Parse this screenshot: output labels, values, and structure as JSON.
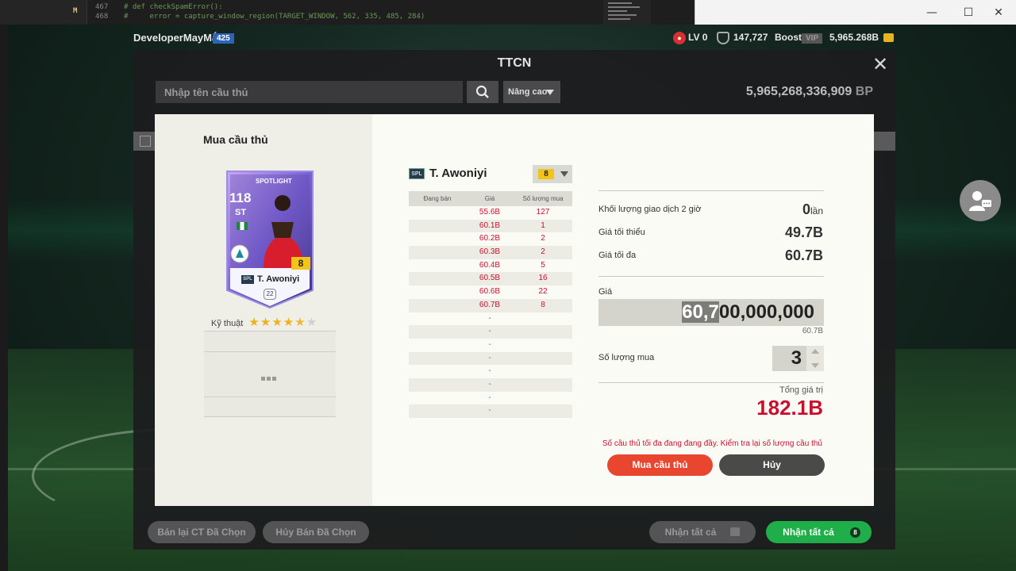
{
  "editor": {
    "modified_mark": "M",
    "lines": [
      {
        "num": "467",
        "text": "# def checkSpamError():"
      },
      {
        "num": "468",
        "text": "#     error = capture_window_region(TARGET_WINDOW, 562, 335, 485, 284)"
      }
    ]
  },
  "window": {
    "minimize": "—",
    "maximize": "☐",
    "close": "✕"
  },
  "topbar": {
    "username": "DeveloperMayMắn",
    "user_badge": "425",
    "level": "LV 0",
    "points": "147,727",
    "boost_label": "Boost",
    "vip_label": "VIP",
    "bp": "5,965.268B"
  },
  "panel": {
    "title": "TTCN",
    "search_placeholder": "Nhập tên cầu thủ",
    "advanced_label": "Nâng cao",
    "bp_value": "5,965,268,336,909",
    "bp_unit": "BP",
    "resell_button": "Bán lại CT Đã Chọn",
    "cancel_sell_button": "Hủy Bán Đã Chọn",
    "receive_all_grey": "Nhận tất cả",
    "receive_all_green": "Nhận tất cả",
    "receive_count": "8"
  },
  "dialog": {
    "title": "Mua cầu thủ",
    "card": {
      "ovr": "118",
      "position": "ST",
      "season": "SPOTLIGHT",
      "name": "T. Awoniyi",
      "league_badge": "SPL",
      "upgrade_level": "8",
      "skill_level": "22"
    },
    "skill_label": "Kỹ thuật",
    "skill_stars": 5,
    "skill_stars_filled": 4.5,
    "player_name": "T. Awoniyi",
    "league_badge": "SPL",
    "selected_level": "8",
    "orders": {
      "headers": [
        "Đang bán",
        "Giá",
        "Số lượng mua"
      ],
      "rows": [
        {
          "selling": "",
          "price": "55.6B",
          "qty": "127"
        },
        {
          "selling": "",
          "price": "60.1B",
          "qty": "1"
        },
        {
          "selling": "",
          "price": "60.2B",
          "qty": "2"
        },
        {
          "selling": "",
          "price": "60.3B",
          "qty": "2"
        },
        {
          "selling": "",
          "price": "60.4B",
          "qty": "5"
        },
        {
          "selling": "",
          "price": "60.5B",
          "qty": "16"
        },
        {
          "selling": "",
          "price": "60.6B",
          "qty": "22"
        },
        {
          "selling": "",
          "price": "60.7B",
          "qty": "8"
        },
        {
          "selling": "",
          "price": "-",
          "qty": ""
        },
        {
          "selling": "",
          "price": "-",
          "qty": ""
        },
        {
          "selling": "",
          "price": "-",
          "qty": ""
        },
        {
          "selling": "",
          "price": "-",
          "qty": ""
        },
        {
          "selling": "",
          "price": "-",
          "qty": ""
        },
        {
          "selling": "",
          "price": "-",
          "qty": ""
        },
        {
          "selling": "",
          "price": "-",
          "qty": ""
        },
        {
          "selling": "",
          "price": "-",
          "qty": ""
        }
      ]
    },
    "volume_label": "Khối lượng giao dịch 2 giờ",
    "volume_value": "0",
    "volume_unit": "lần",
    "min_label": "Giá tối thiểu",
    "min_value": "49.7B",
    "max_label": "Giá tối đa",
    "max_value": "60.7B",
    "price_label": "Giá",
    "price_selected": "60,7",
    "price_rest": "00,000,000",
    "price_short": "60.7B",
    "qty_label": "Số lượng mua",
    "qty_value": "3",
    "total_label": "Tổng giá trị",
    "total_value": "182.1B",
    "warning": "Số cầu thủ tối đa đang đang đầy. Kiểm tra lại số lượng cầu thủ",
    "buy_button": "Mua cầu thủ",
    "cancel_button": "Hủy"
  },
  "colors": {
    "accent_red": "#c8102e",
    "buy": "#e8462e",
    "green": "#1fae4a",
    "badge_blue": "#2e64b8"
  }
}
